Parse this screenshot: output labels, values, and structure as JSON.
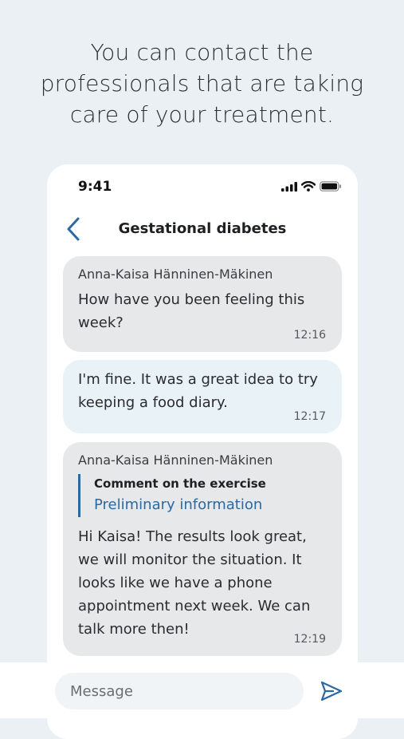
{
  "headline": {
    "lines": [
      "You can contact the",
      "professionals that are taking",
      "care of your treatment."
    ]
  },
  "status_bar": {
    "time": "9:41"
  },
  "nav": {
    "title": "Gestational diabetes",
    "back_icon": "chevron-left-icon"
  },
  "messages": [
    {
      "direction": "incoming",
      "sender": "Anna-Kaisa Hänninen-Mäkinen",
      "lines": [
        "How have you been feeling this",
        "week?"
      ],
      "time": "12:16"
    },
    {
      "direction": "outgoing",
      "lines": [
        "I'm fine. It was a great idea to try",
        "keeping a food diary."
      ],
      "time": "12:17"
    },
    {
      "direction": "incoming",
      "sender": "Anna-Kaisa Hänninen-Mäkinen",
      "quote": {
        "title": "Comment on the exercise",
        "link": "Preliminary information"
      },
      "lines": [
        "Hi Kaisa! The results look great,",
        "we will monitor the situation. It",
        "looks like we have a phone",
        "appointment next week. We can",
        "talk more then!"
      ],
      "time": "12:19"
    }
  ],
  "composer": {
    "placeholder": "Message",
    "value": "",
    "send_icon": "send-icon"
  },
  "colors": {
    "accent": "#2b6aa0",
    "page_bg": "#eaf0f3",
    "incoming_bubble": "#e6e8ea",
    "outgoing_bubble": "#e9f2f6"
  }
}
